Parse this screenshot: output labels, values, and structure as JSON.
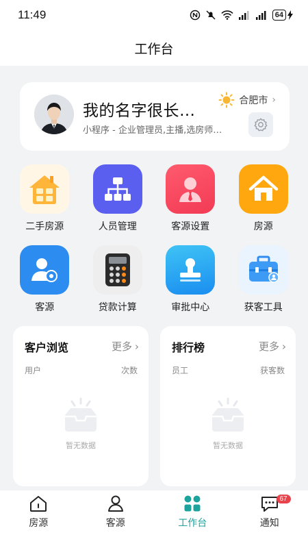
{
  "status_bar": {
    "time": "11:49",
    "battery": "64"
  },
  "header": {
    "title": "工作台"
  },
  "profile": {
    "name": "我的名字很长…",
    "subtitle": "小程序 - 企业管理员,主播,选房师…",
    "city": "合肥市"
  },
  "grid": [
    {
      "label": "二手房源",
      "icon": "house-windows-icon"
    },
    {
      "label": "人员管理",
      "icon": "org-chart-icon"
    },
    {
      "label": "客源设置",
      "icon": "person-tie-icon"
    },
    {
      "label": "房源",
      "icon": "home-icon"
    },
    {
      "label": "客源",
      "icon": "user-gear-icon"
    },
    {
      "label": "贷款计算",
      "icon": "calculator-icon"
    },
    {
      "label": "审批中心",
      "icon": "stamp-icon"
    },
    {
      "label": "获客工具",
      "icon": "toolbox-icon"
    }
  ],
  "cards": {
    "browse": {
      "title": "客户浏览",
      "more": "更多",
      "col1": "用户",
      "col2": "次数",
      "empty": "暂无数据"
    },
    "ranking": {
      "title": "排行榜",
      "more": "更多",
      "col1": "员工",
      "col2": "获客数",
      "empty": "暂无数据"
    }
  },
  "tabbar": {
    "items": [
      {
        "label": "房源",
        "icon": "house-outline-icon"
      },
      {
        "label": "客源",
        "icon": "person-outline-icon"
      },
      {
        "label": "工作台",
        "icon": "workbench-icon"
      },
      {
        "label": "通知",
        "icon": "chat-bubble-icon"
      }
    ],
    "notification_badge": "67"
  },
  "colors": {
    "accent": "#1ca39e",
    "badge": "#e8434a"
  }
}
